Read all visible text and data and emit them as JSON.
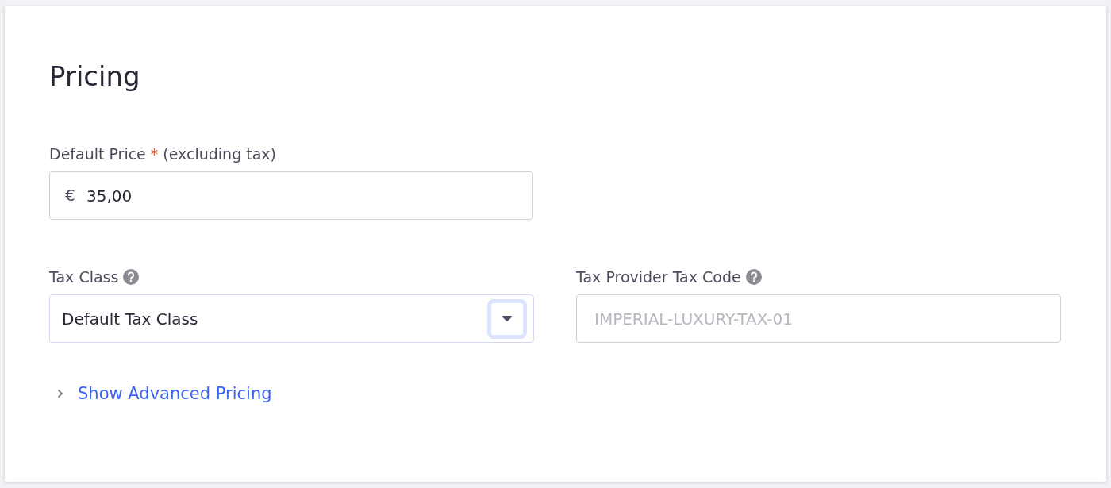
{
  "title": "Pricing",
  "price": {
    "label": "Default Price",
    "required": true,
    "required_mark": "*",
    "hint": "(excluding tax)",
    "currency": "€",
    "value": "35,00"
  },
  "tax_class": {
    "label": "Tax Class",
    "help": true,
    "value": "Default Tax Class",
    "focused": true
  },
  "tax_code": {
    "label": "Tax Provider Tax Code",
    "help": true,
    "placeholder": "IMPERIAL-LUXURY-TAX-01"
  },
  "advanced_link": {
    "label": "Show Advanced Pricing",
    "expanded": false
  }
}
